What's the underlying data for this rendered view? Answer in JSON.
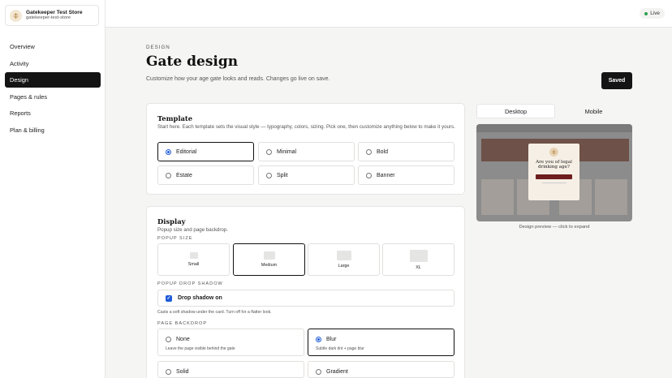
{
  "store": {
    "name": "Gatekeeper Test Store",
    "handle": "gatekeeper-test-store"
  },
  "nav": {
    "items": [
      {
        "label": "Overview"
      },
      {
        "label": "Activity"
      },
      {
        "label": "Design"
      },
      {
        "label": "Pages & rules"
      },
      {
        "label": "Reports"
      },
      {
        "label": "Plan & billing"
      }
    ]
  },
  "status": {
    "label": "Live"
  },
  "header": {
    "eyebrow": "DESIGN",
    "title": "Gate design",
    "subtitle": "Customize how your age gate looks and reads. Changes go live on save.",
    "save_label": "Saved"
  },
  "template": {
    "title": "Template",
    "description": "Start here. Each template sets the visual style — typography, colors, sizing. Pick one, then customize anything below to make it yours.",
    "options": [
      {
        "label": "Editorial"
      },
      {
        "label": "Minimal"
      },
      {
        "label": "Bold"
      },
      {
        "label": "Estate"
      },
      {
        "label": "Split"
      },
      {
        "label": "Banner"
      }
    ]
  },
  "display": {
    "title": "Display",
    "description": "Popup size and page backdrop.",
    "popup_size_label": "POPUP SIZE",
    "sizes": [
      {
        "label": "Small"
      },
      {
        "label": "Medium"
      },
      {
        "label": "Large"
      },
      {
        "label": "XL"
      }
    ],
    "shadow_label": "POPUP DROP SHADOW",
    "shadow_option": "Drop shadow on",
    "shadow_hint": "Casts a soft shadow under the card. Turn off for a flatter look.",
    "backdrop_label": "PAGE BACKDROP",
    "backdrops": [
      {
        "label": "None",
        "sub": "Leave the page visible behind the gate"
      },
      {
        "label": "Blur",
        "sub": "Subtle dark tint + page blur"
      },
      {
        "label": "Solid"
      },
      {
        "label": "Gradient"
      }
    ]
  },
  "preview": {
    "tabs": [
      {
        "label": "Desktop"
      },
      {
        "label": "Mobile"
      }
    ],
    "modal_question": "Are you of legal drinking age?",
    "caption": "Design preview — click to expand"
  },
  "colors": {
    "accent": "#1f5bd8",
    "primary": "#141414",
    "live": "#2e9e4f"
  }
}
